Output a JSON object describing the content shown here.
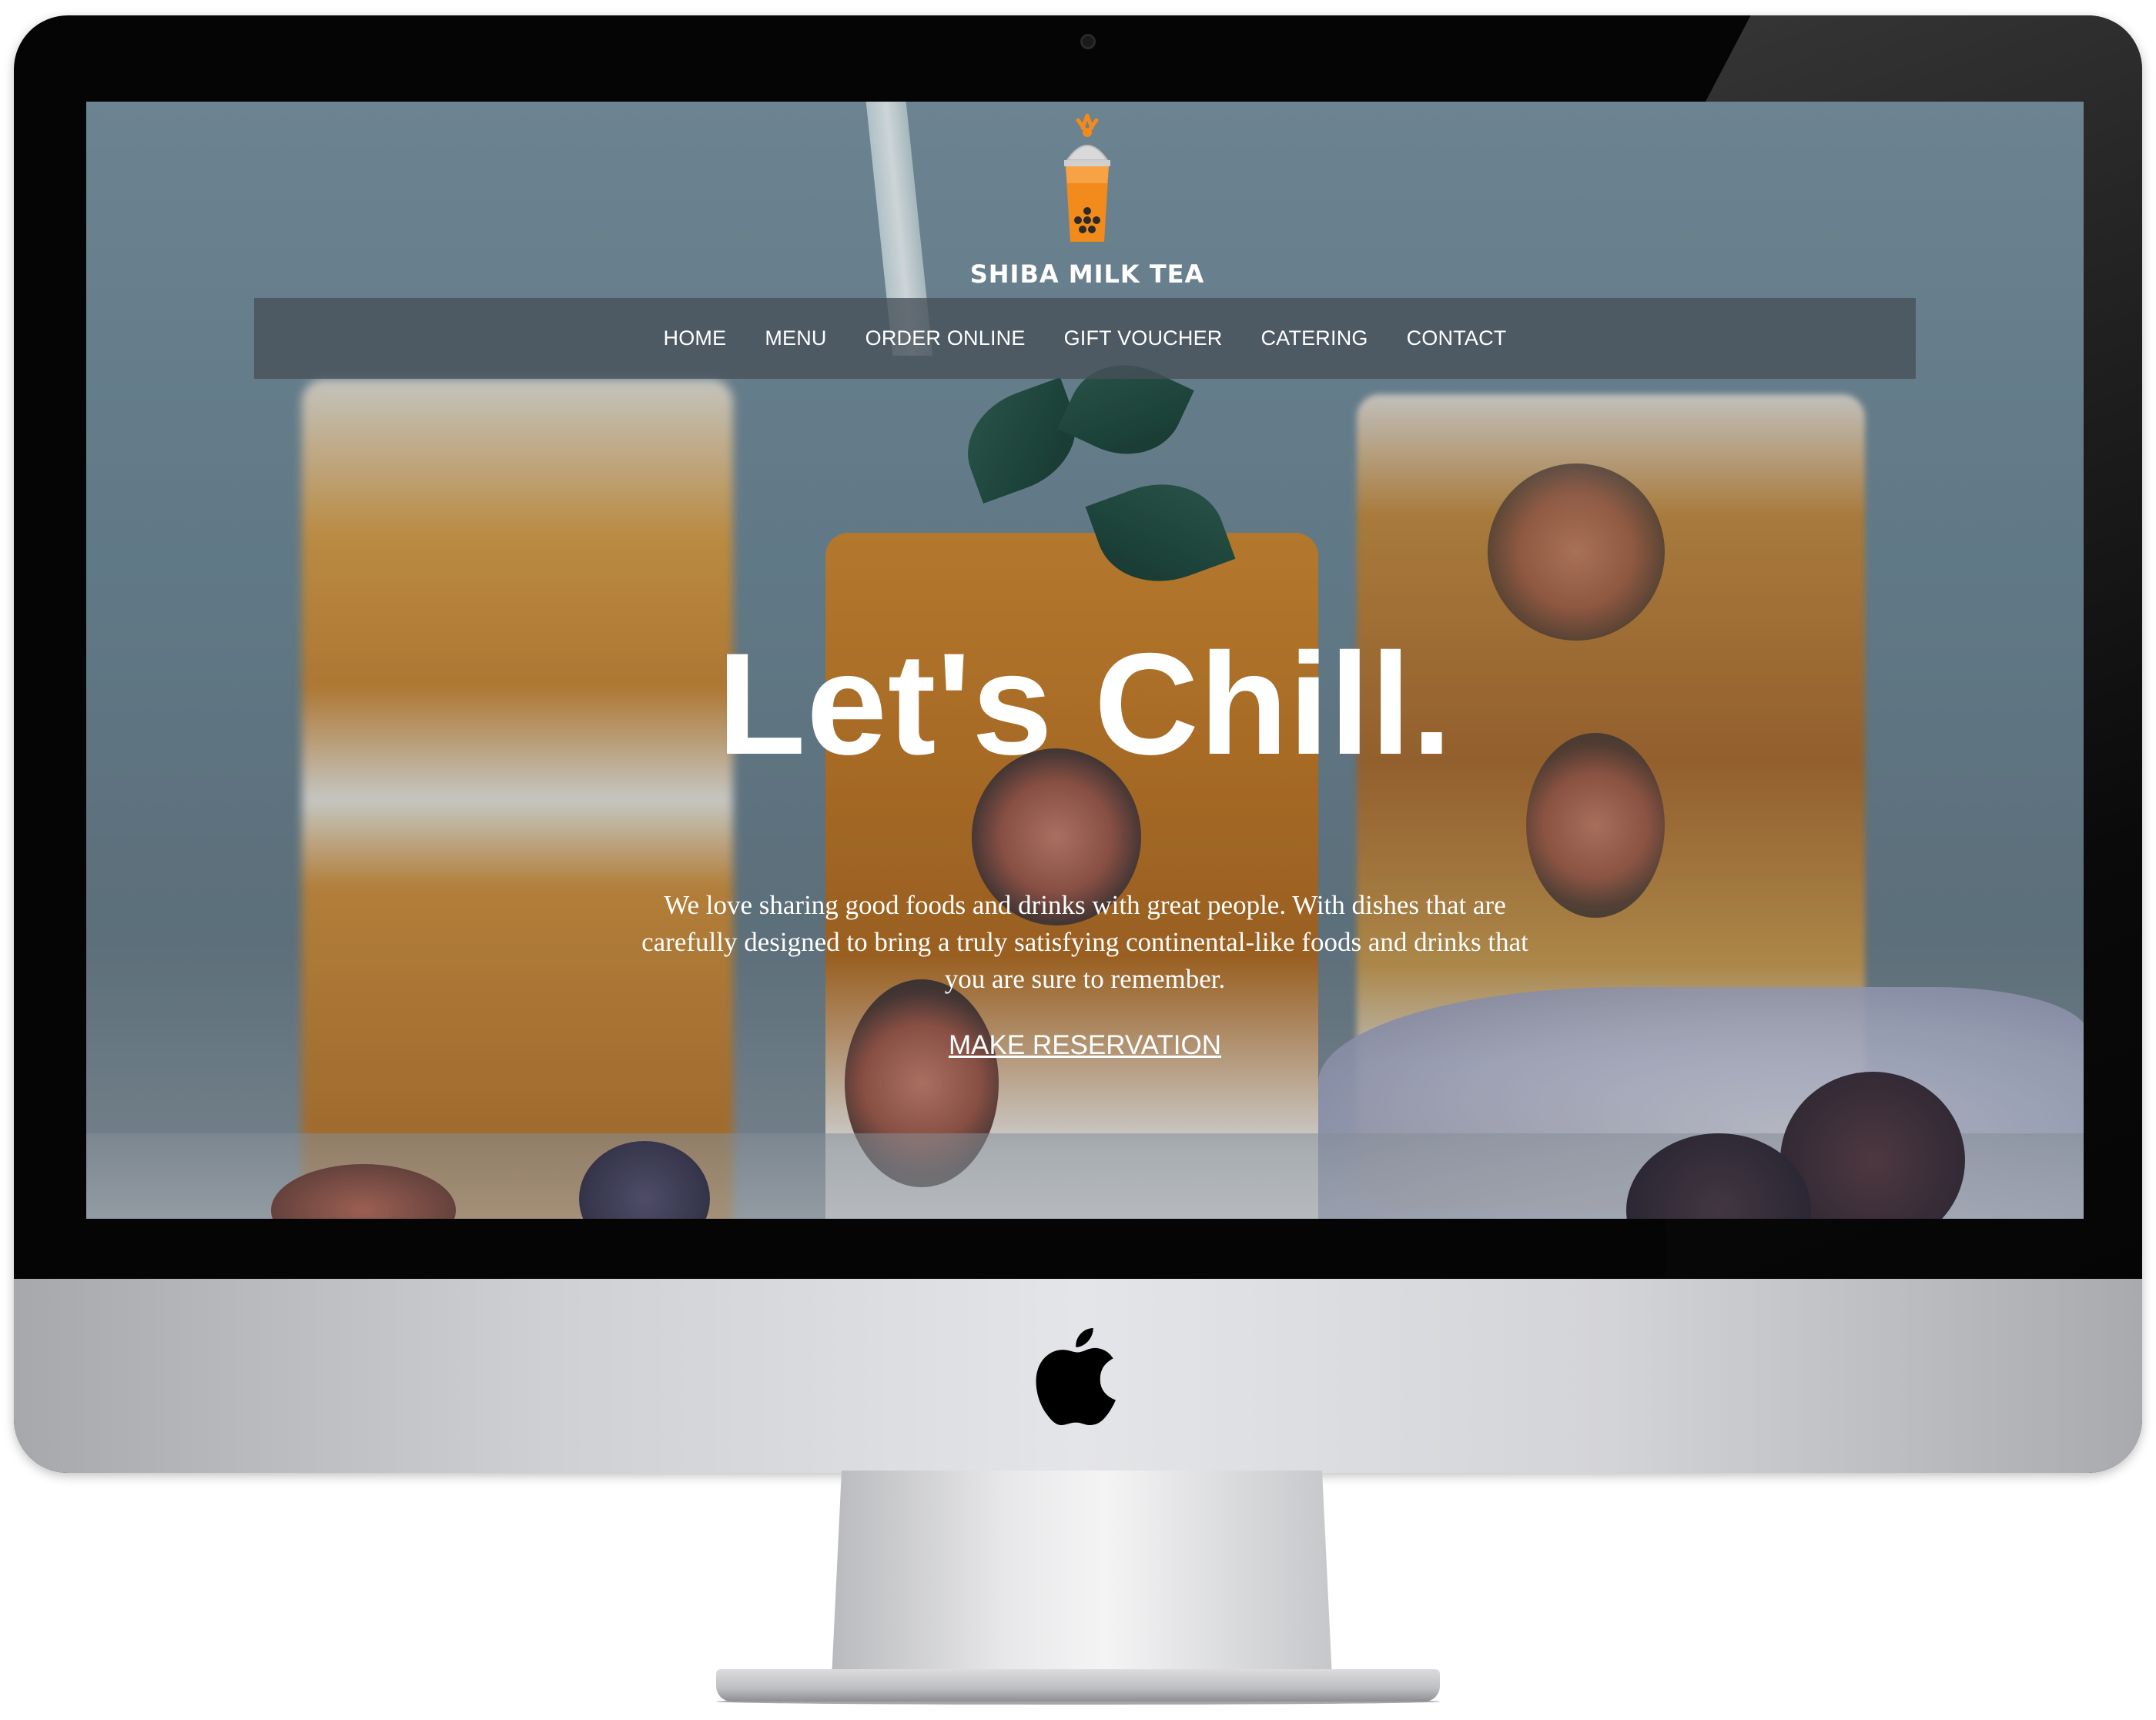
{
  "brand": {
    "name": "SHIBA MILK TEA",
    "logo_icon": "bubble-tea-cup-icon",
    "accent_color": "#f28a1c"
  },
  "nav": {
    "items": [
      {
        "label": "HOME"
      },
      {
        "label": "MENU"
      },
      {
        "label": "ORDER ONLINE"
      },
      {
        "label": "GIFT VOUCHER"
      },
      {
        "label": "CATERING"
      },
      {
        "label": "CONTACT"
      }
    ]
  },
  "hero": {
    "title": "Let's Chill.",
    "description": "We love sharing good foods and drinks with great people. With dishes that are carefully designed to bring a truly satisfying continental-like foods and drinks that you are sure to remember.",
    "cta_label": "MAKE RESERVATION"
  },
  "device": {
    "icon": "apple-logo-icon"
  }
}
